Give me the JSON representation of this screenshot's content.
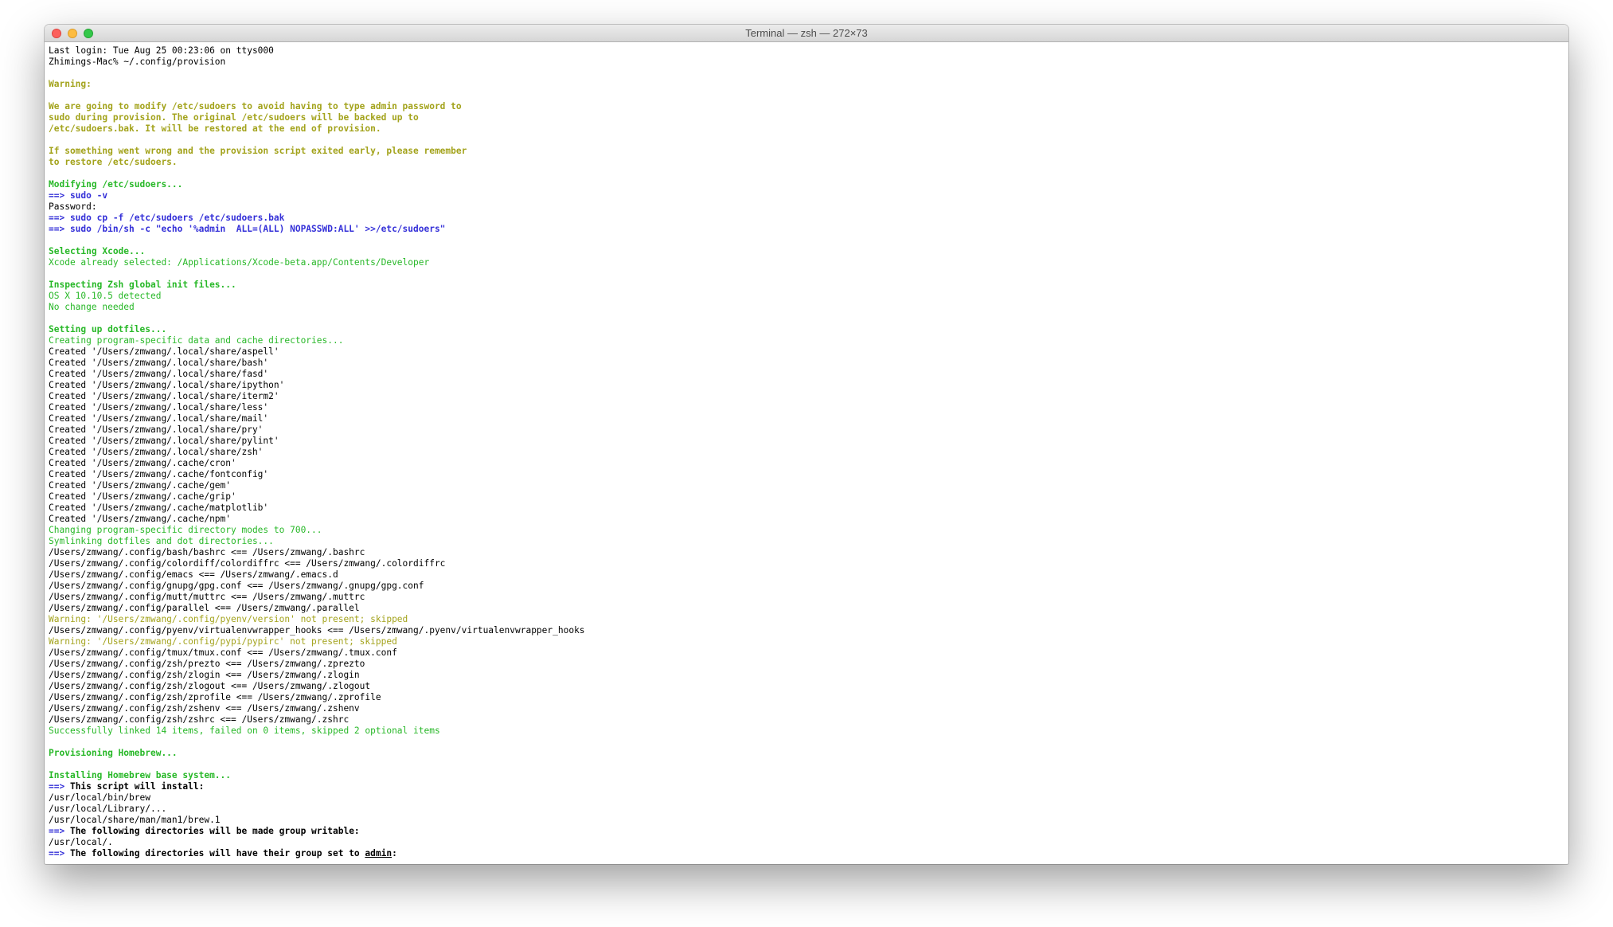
{
  "window": {
    "title": "Terminal — zsh — 272×73"
  },
  "colors": {
    "yellow": "#a3a31c",
    "green": "#28b828",
    "blue": "#3430d8",
    "close": "#fc605c",
    "minimize": "#fdbc40",
    "zoom": "#34c84a"
  },
  "icons": [
    "close-icon",
    "minimize-icon",
    "zoom-icon"
  ],
  "terminal": {
    "lines": [
      {
        "style": "plain",
        "text": "Last login: Tue Aug 25 00:23:06 on ttys000"
      },
      {
        "style": "plain",
        "text": "Zhimings-Mac% ~/.config/provision"
      },
      {
        "style": "blank",
        "text": ""
      },
      {
        "style": "yellow-bold",
        "text": "Warning:"
      },
      {
        "style": "blank",
        "text": ""
      },
      {
        "style": "yellow-bold",
        "text": "We are going to modify /etc/sudoers to avoid having to type admin password to"
      },
      {
        "style": "yellow-bold",
        "text": "sudo during provision. The original /etc/sudoers will be backed up to"
      },
      {
        "style": "yellow-bold",
        "text": "/etc/sudoers.bak. It will be restored at the end of provision."
      },
      {
        "style": "blank",
        "text": ""
      },
      {
        "style": "yellow-bold",
        "text": "If something went wrong and the provision script exited early, please remember"
      },
      {
        "style": "yellow-bold",
        "text": "to restore /etc/sudoers."
      },
      {
        "style": "blank",
        "text": ""
      },
      {
        "style": "green-bold",
        "text": "Modifying /etc/sudoers..."
      },
      {
        "style": "blue-bold",
        "text": "==> sudo -v"
      },
      {
        "style": "plain",
        "text": "Password:"
      },
      {
        "style": "blue-bold",
        "text": "==> sudo cp -f /etc/sudoers /etc/sudoers.bak"
      },
      {
        "style": "blue-bold",
        "text": "==> sudo /bin/sh -c \"echo '%admin  ALL=(ALL) NOPASSWD:ALL' >>/etc/sudoers\""
      },
      {
        "style": "blank",
        "text": ""
      },
      {
        "style": "green-bold",
        "text": "Selecting Xcode..."
      },
      {
        "style": "green",
        "text": "Xcode already selected: /Applications/Xcode-beta.app/Contents/Developer"
      },
      {
        "style": "blank",
        "text": ""
      },
      {
        "style": "green-bold",
        "text": "Inspecting Zsh global init files..."
      },
      {
        "style": "green",
        "text": "OS X 10.10.5 detected"
      },
      {
        "style": "green",
        "text": "No change needed"
      },
      {
        "style": "blank",
        "text": ""
      },
      {
        "style": "green-bold",
        "text": "Setting up dotfiles..."
      },
      {
        "style": "green",
        "text": "Creating program-specific data and cache directories..."
      },
      {
        "style": "plain",
        "text": "Created '/Users/zmwang/.local/share/aspell'"
      },
      {
        "style": "plain",
        "text": "Created '/Users/zmwang/.local/share/bash'"
      },
      {
        "style": "plain",
        "text": "Created '/Users/zmwang/.local/share/fasd'"
      },
      {
        "style": "plain",
        "text": "Created '/Users/zmwang/.local/share/ipython'"
      },
      {
        "style": "plain",
        "text": "Created '/Users/zmwang/.local/share/iterm2'"
      },
      {
        "style": "plain",
        "text": "Created '/Users/zmwang/.local/share/less'"
      },
      {
        "style": "plain",
        "text": "Created '/Users/zmwang/.local/share/mail'"
      },
      {
        "style": "plain",
        "text": "Created '/Users/zmwang/.local/share/pry'"
      },
      {
        "style": "plain",
        "text": "Created '/Users/zmwang/.local/share/pylint'"
      },
      {
        "style": "plain",
        "text": "Created '/Users/zmwang/.local/share/zsh'"
      },
      {
        "style": "plain",
        "text": "Created '/Users/zmwang/.cache/cron'"
      },
      {
        "style": "plain",
        "text": "Created '/Users/zmwang/.cache/fontconfig'"
      },
      {
        "style": "plain",
        "text": "Created '/Users/zmwang/.cache/gem'"
      },
      {
        "style": "plain",
        "text": "Created '/Users/zmwang/.cache/grip'"
      },
      {
        "style": "plain",
        "text": "Created '/Users/zmwang/.cache/matplotlib'"
      },
      {
        "style": "plain",
        "text": "Created '/Users/zmwang/.cache/npm'"
      },
      {
        "style": "green",
        "text": "Changing program-specific directory modes to 700..."
      },
      {
        "style": "green",
        "text": "Symlinking dotfiles and dot directories..."
      },
      {
        "style": "plain",
        "text": "/Users/zmwang/.config/bash/bashrc <== /Users/zmwang/.bashrc"
      },
      {
        "style": "plain",
        "text": "/Users/zmwang/.config/colordiff/colordiffrc <== /Users/zmwang/.colordiffrc"
      },
      {
        "style": "plain",
        "text": "/Users/zmwang/.config/emacs <== /Users/zmwang/.emacs.d"
      },
      {
        "style": "plain",
        "text": "/Users/zmwang/.config/gnupg/gpg.conf <== /Users/zmwang/.gnupg/gpg.conf"
      },
      {
        "style": "plain",
        "text": "/Users/zmwang/.config/mutt/muttrc <== /Users/zmwang/.muttrc"
      },
      {
        "style": "plain",
        "text": "/Users/zmwang/.config/parallel <== /Users/zmwang/.parallel"
      },
      {
        "style": "yellow",
        "text": "Warning: '/Users/zmwang/.config/pyenv/version' not present; skipped"
      },
      {
        "style": "plain",
        "text": "/Users/zmwang/.config/pyenv/virtualenvwrapper_hooks <== /Users/zmwang/.pyenv/virtualenvwrapper_hooks"
      },
      {
        "style": "yellow",
        "text": "Warning: '/Users/zmwang/.config/pypi/pypirc' not present; skipped"
      },
      {
        "style": "plain",
        "text": "/Users/zmwang/.config/tmux/tmux.conf <== /Users/zmwang/.tmux.conf"
      },
      {
        "style": "plain",
        "text": "/Users/zmwang/.config/zsh/prezto <== /Users/zmwang/.zprezto"
      },
      {
        "style": "plain",
        "text": "/Users/zmwang/.config/zsh/zlogin <== /Users/zmwang/.zlogin"
      },
      {
        "style": "plain",
        "text": "/Users/zmwang/.config/zsh/zlogout <== /Users/zmwang/.zlogout"
      },
      {
        "style": "plain",
        "text": "/Users/zmwang/.config/zsh/zprofile <== /Users/zmwang/.zprofile"
      },
      {
        "style": "plain",
        "text": "/Users/zmwang/.config/zsh/zshenv <== /Users/zmwang/.zshenv"
      },
      {
        "style": "plain",
        "text": "/Users/zmwang/.config/zsh/zshrc <== /Users/zmwang/.zshrc"
      },
      {
        "style": "green",
        "text": "Successfully linked 14 items, failed on 0 items, skipped 2 optional items"
      },
      {
        "style": "blank",
        "text": ""
      },
      {
        "style": "green-bold",
        "text": "Provisioning Homebrew..."
      },
      {
        "style": "blank",
        "text": ""
      },
      {
        "style": "green-bold",
        "text": "Installing Homebrew base system..."
      },
      {
        "style": "arrow-bold",
        "arrow": "==>",
        "text": " This script will install:"
      },
      {
        "style": "plain",
        "text": "/usr/local/bin/brew"
      },
      {
        "style": "plain",
        "text": "/usr/local/Library/..."
      },
      {
        "style": "plain",
        "text": "/usr/local/share/man/man1/brew.1"
      },
      {
        "style": "arrow-bold",
        "arrow": "==>",
        "text": " The following directories will be made group writable:"
      },
      {
        "style": "plain",
        "text": "/usr/local/."
      },
      {
        "style": "arrow-bold-ul",
        "arrow": "==>",
        "text": " The following directories will have their group set to ",
        "underline": "admin",
        "after": ":"
      }
    ]
  }
}
